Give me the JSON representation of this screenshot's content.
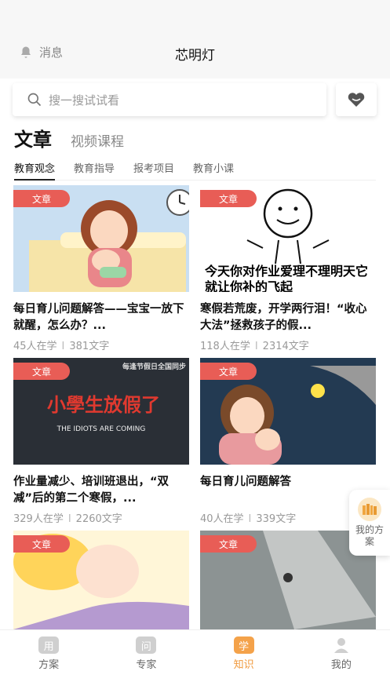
{
  "header": {
    "message_label": "消息",
    "title": "芯明灯"
  },
  "search": {
    "placeholder": "搜一搜试试看"
  },
  "main_tabs": [
    {
      "label": "文章"
    },
    {
      "label": "视频课程"
    }
  ],
  "sub_tabs": [
    {
      "label": "教育观念"
    },
    {
      "label": "教育指导"
    },
    {
      "label": "报考项目"
    },
    {
      "label": "教育小课"
    }
  ],
  "cards": [
    {
      "badge": "文章",
      "title": "每日育儿问题解答——宝宝一放下就醒，怎么办？...",
      "learners": "45人在学",
      "words": "381文字"
    },
    {
      "badge": "文章",
      "title": "寒假若荒废，开学两行泪！“收心大法”拯救孩子的假...",
      "learners": "118人在学",
      "words": "2314文字",
      "thumb_text": "今天你对作业爱理不理明天它就让你补的飞起"
    },
    {
      "badge": "文章",
      "title": "作业量减少、培训班退出，“双减”后的第二个寒假，...",
      "learners": "329人在学",
      "words": "2260文字",
      "thumb_text": "小學生放假了",
      "thumb_sub": "THE IDIOTS ARE COMING",
      "thumb_top": "每逢节假日全国同步"
    },
    {
      "badge": "文章",
      "title": "每日育儿问题解答",
      "learners": "40人在学",
      "words": "339文字"
    },
    {
      "badge": "文章"
    },
    {
      "badge": "文章"
    }
  ],
  "float_plan": {
    "label": "我的方案"
  },
  "tabbar": [
    {
      "icon_char": "用",
      "label": "方案",
      "icon": "plan-icon"
    },
    {
      "icon_char": "问",
      "label": "专家",
      "icon": "expert-icon"
    },
    {
      "icon_char": "学",
      "label": "知识",
      "icon": "knowledge-icon"
    },
    {
      "icon_char": "",
      "label": "我的",
      "icon": "person-icon"
    }
  ],
  "colors": {
    "accent": "#f0993c",
    "badge": "#e85d56"
  }
}
